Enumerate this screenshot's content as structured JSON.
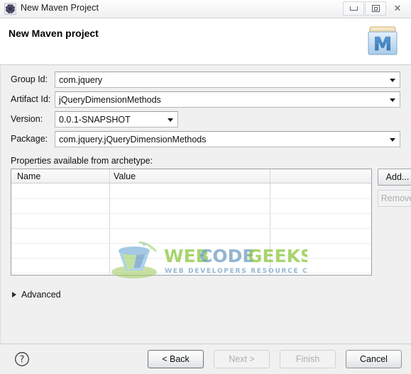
{
  "window": {
    "title": "New Maven Project",
    "icon": "eclipse-icon",
    "controls": {
      "minimize": "minimize-icon",
      "restore": "restore-icon",
      "close": "close-icon",
      "close_glyph": "✕"
    }
  },
  "header": {
    "title": "New Maven project",
    "icon": "maven-project-icon",
    "icon_letter": "M"
  },
  "form": {
    "fields": [
      {
        "label": "Group Id:",
        "value": "com.jquery",
        "type": "combo-full"
      },
      {
        "label": "Artifact Id:",
        "value": "jQueryDimensionMethods",
        "type": "combo-full"
      },
      {
        "label": "Version:",
        "value": "0.0.1-SNAPSHOT",
        "type": "combo-short"
      },
      {
        "label": "Package:",
        "value": "com.jquery.jQueryDimensionMethods",
        "type": "combo-full"
      }
    ]
  },
  "properties": {
    "label": "Properties available from archetype:",
    "columns": [
      "Name",
      "Value",
      ""
    ],
    "rows": [],
    "buttons": {
      "add": {
        "label": "Add...",
        "enabled": true
      },
      "remove": {
        "label": "Remove",
        "enabled": false
      }
    }
  },
  "watermark": {
    "line1_part1": "WEB",
    "line1_part2": "CODE",
    "line1_part3": "GEEKS",
    "line2": "WEB DEVELOPERS RESOURCE CENTER",
    "color_green": "#8cc63f",
    "color_blue": "#6f9dc4"
  },
  "advanced": {
    "label": "Advanced",
    "expanded": false,
    "icon": "triangle-right-icon"
  },
  "footer": {
    "help": "help-icon",
    "buttons": [
      {
        "label": "< Back",
        "enabled": true,
        "name": "back-button"
      },
      {
        "label": "Next >",
        "enabled": false,
        "name": "next-button"
      },
      {
        "label": "Finish",
        "enabled": false,
        "name": "finish-button"
      },
      {
        "label": "Cancel",
        "enabled": true,
        "name": "cancel-button"
      }
    ]
  }
}
